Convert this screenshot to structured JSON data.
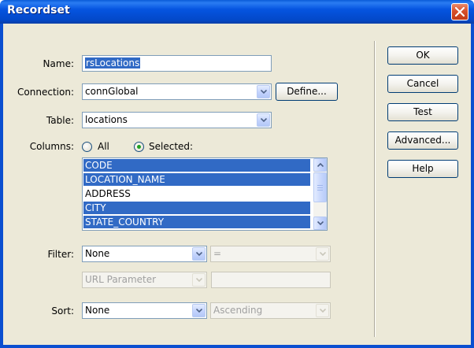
{
  "window": {
    "title": "Recordset"
  },
  "form": {
    "name_label": "Name:",
    "name_value": "rsLocations",
    "connection_label": "Connection:",
    "connection_value": "connGlobal",
    "define_label": "Define...",
    "table_label": "Table:",
    "table_value": "locations",
    "columns_label": "Columns:",
    "columns_all_label": "All",
    "columns_selected_label": "Selected:",
    "columns_mode": "Selected",
    "columns": [
      {
        "name": "CODE",
        "selected": true
      },
      {
        "name": "LOCATION_NAME",
        "selected": true
      },
      {
        "name": "ADDRESS",
        "selected": false
      },
      {
        "name": "CITY",
        "selected": true
      },
      {
        "name": "STATE_COUNTRY",
        "selected": true
      }
    ],
    "filter_label": "Filter:",
    "filter_value": "None",
    "filter_operator": "=",
    "filter_param_type": "URL Parameter",
    "filter_param_value": "",
    "sort_label": "Sort:",
    "sort_value": "None",
    "sort_order": "Ascending"
  },
  "buttons": {
    "ok": "OK",
    "cancel": "Cancel",
    "test": "Test",
    "advanced": "Advanced...",
    "help": "Help"
  },
  "colors": {
    "title_bar": "#0554e0",
    "dialog_bg": "#ece9d8",
    "selection": "#316ac5",
    "close_button": "#d7502b"
  }
}
